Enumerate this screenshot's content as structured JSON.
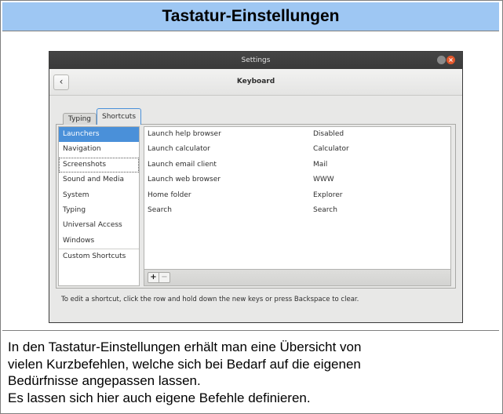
{
  "page": {
    "heading": "Tastatur-Einstellungen",
    "description_lines": [
      "In den Tastatur-Einstellungen erhält man eine Übersicht von",
      "vielen Kurzbefehlen, welche sich bei Bedarf auf die eigenen",
      "Bedürfnisse angepassen lassen.",
      "Es lassen sich hier auch eigene Befehle definieren."
    ]
  },
  "window": {
    "title": "Settings",
    "panel_title": "Keyboard",
    "back_glyph": "‹",
    "close_glyph": "×"
  },
  "tabs": {
    "typing": "Typing",
    "shortcuts": "Shortcuts"
  },
  "sidebar": {
    "items": [
      "Launchers",
      "Navigation",
      "Screenshots",
      "Sound and Media",
      "System",
      "Typing",
      "Universal Access",
      "Windows",
      "Custom Shortcuts"
    ],
    "selected": "Launchers"
  },
  "shortcuts": {
    "rows": [
      {
        "description": "Launch help browser",
        "accelerator": "Disabled"
      },
      {
        "description": "Launch calculator",
        "accelerator": "Calculator"
      },
      {
        "description": "Launch email client",
        "accelerator": "Mail"
      },
      {
        "description": "Launch web browser",
        "accelerator": "WWW"
      },
      {
        "description": "Home folder",
        "accelerator": "Explorer"
      },
      {
        "description": "Search",
        "accelerator": "Search"
      }
    ],
    "add_glyph": "+",
    "remove_glyph": "−"
  },
  "hint": "To edit a shortcut, click the row and hold down the new keys or press Backspace to clear.",
  "colors": {
    "header_bg": "#9ec7f3",
    "selection": "#4a90d9",
    "close_button": "#e2572c",
    "titlebar": "#3a3a3a"
  }
}
